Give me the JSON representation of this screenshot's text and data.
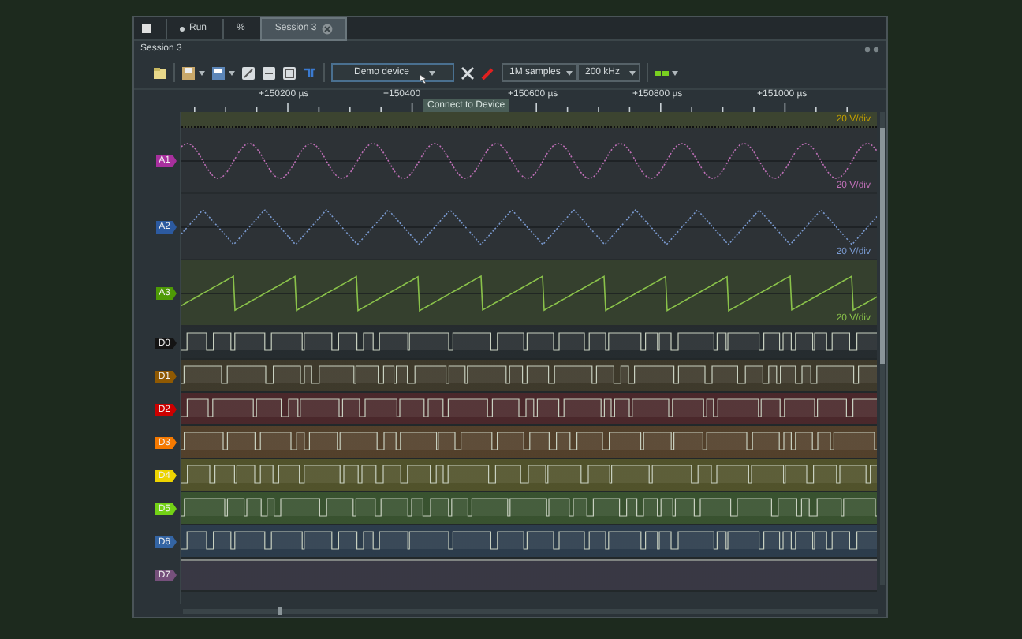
{
  "tabs": [
    {
      "label": "Run",
      "kind": "run",
      "selected": false
    },
    {
      "label": "%",
      "kind": "text",
      "selected": false
    },
    {
      "label": "Session 3",
      "kind": "session",
      "selected": true
    }
  ],
  "session_title": "Session 3",
  "toolbar": {
    "device": "Demo device",
    "tooltip": "Connect to Device",
    "samples": "1M samples",
    "rate": "200 kHz"
  },
  "ruler": {
    "ticks": [
      "+150200 µs",
      "+150400",
      "+150600 µs",
      "+150800 µs",
      "+151000 µs"
    ]
  },
  "top_scale": "20 V/div",
  "analog": [
    {
      "label": "A1",
      "kind": "sine",
      "color": "#a8309e",
      "scale": "20 V/div"
    },
    {
      "label": "A2",
      "kind": "triangle",
      "color": "#2c5aa0",
      "scale": "20 V/div"
    },
    {
      "label": "A3",
      "kind": "sawtooth",
      "color": "#4e9a06",
      "scale": "20 V/div"
    }
  ],
  "digital": [
    {
      "label": "D0",
      "color": "#141414"
    },
    {
      "label": "D1",
      "color": "#8f5902"
    },
    {
      "label": "D2",
      "color": "#cc0000"
    },
    {
      "label": "D3",
      "color": "#f57900"
    },
    {
      "label": "D4",
      "color": "#edd400"
    },
    {
      "label": "D5",
      "color": "#73d216"
    },
    {
      "label": "D6",
      "color": "#3465a4"
    },
    {
      "label": "D7",
      "color": "#75507b"
    }
  ]
}
